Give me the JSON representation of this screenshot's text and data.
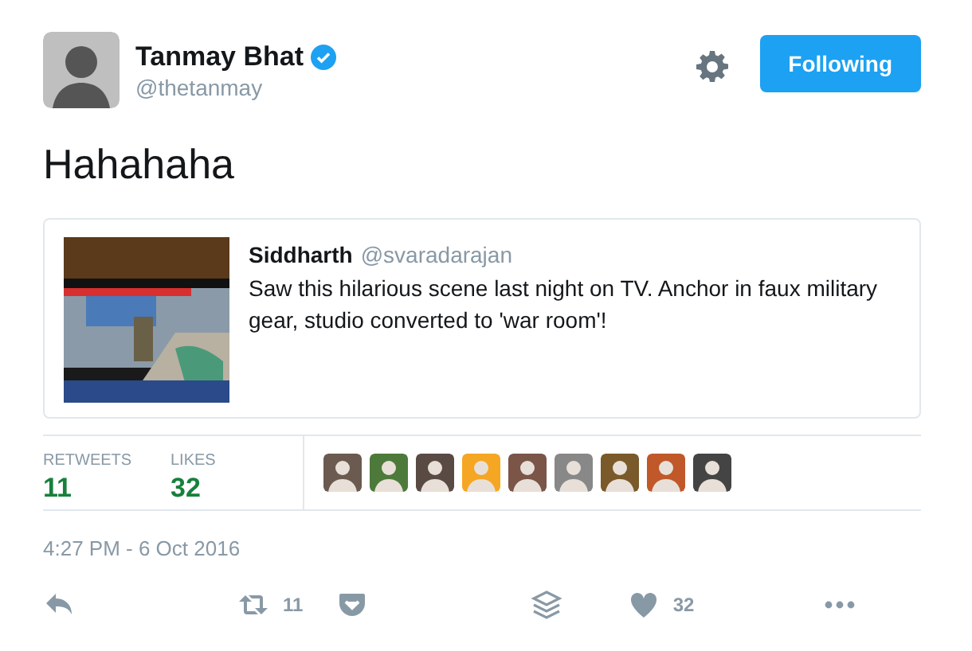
{
  "author": {
    "name": "Tanmay Bhat",
    "verified": true,
    "handle": "@thetanmay"
  },
  "follow_button": {
    "label": "Following",
    "following": true
  },
  "text": "Hahahaha",
  "quoted_tweet": {
    "name": "Siddharth",
    "handle": "@svaradarajan",
    "text": "Saw this hilarious scene last night on TV. Anchor in faux military gear, studio converted to 'war room'!"
  },
  "stats": [
    {
      "label": "RETWEETS",
      "value": "11"
    },
    {
      "label": "LIKES",
      "value": "32"
    }
  ],
  "liker_avatars": [
    {
      "color": "#6b5a50"
    },
    {
      "color": "#4d7a3a"
    },
    {
      "color": "#5a4a44"
    },
    {
      "color": "#f5a623"
    },
    {
      "color": "#7a5548"
    },
    {
      "color": "#888888"
    },
    {
      "color": "#7a5a2a"
    },
    {
      "color": "#c0582a"
    },
    {
      "color": "#444444"
    }
  ],
  "timestamp": "4:27 PM - 6 Oct 2016",
  "actions": [
    {
      "kind": "reply"
    },
    {
      "kind": "retweet",
      "count": "11"
    },
    {
      "kind": "pocket"
    },
    {
      "kind": "buffer"
    },
    {
      "kind": "like",
      "count": "32"
    },
    {
      "kind": "more"
    }
  ]
}
